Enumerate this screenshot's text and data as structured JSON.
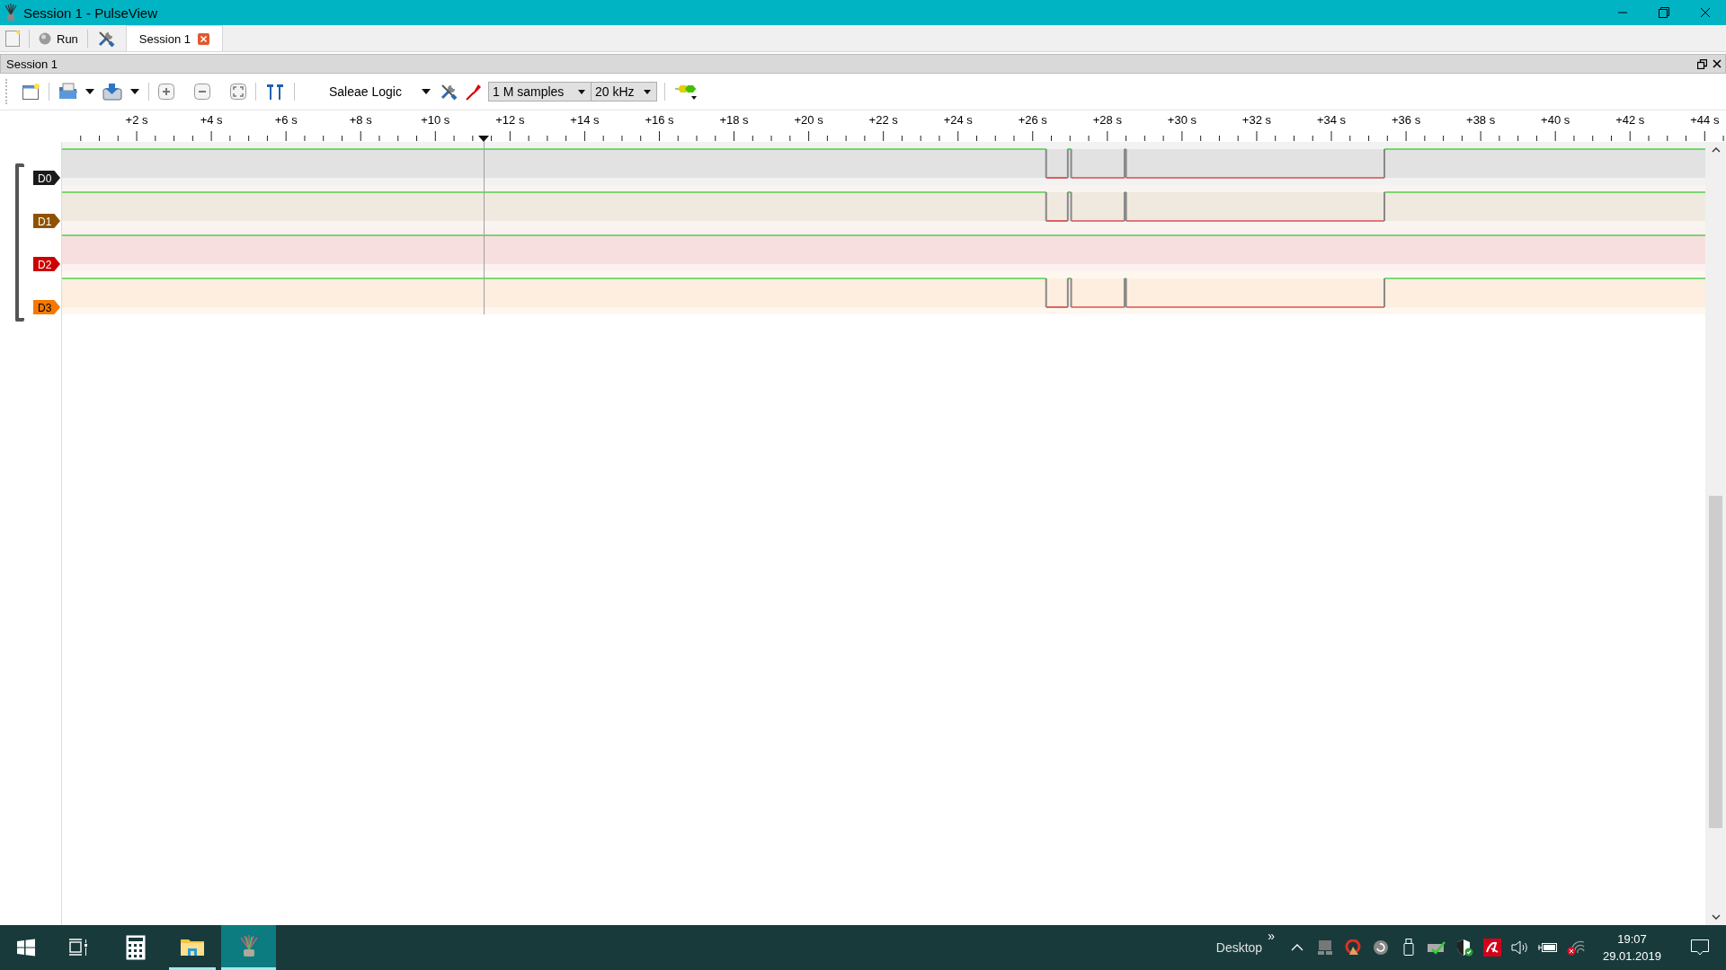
{
  "window": {
    "title": "Session 1 - PulseView"
  },
  "main_toolbar": {
    "run_button": "Run"
  },
  "tabs": [
    {
      "label": "Session 1",
      "selected": true
    }
  ],
  "session_panel": {
    "title": "Session 1"
  },
  "toolbar": {
    "device": "Saleae Logic",
    "samples": "1 M samples",
    "rate": "20 kHz"
  },
  "ruler": {
    "ticks": [
      "+2 s",
      "+4 s",
      "+6 s",
      "+8 s",
      "+10 s",
      "+12 s",
      "+14 s",
      "+16 s",
      "+18 s",
      "+20 s",
      "+22 s",
      "+24 s",
      "+26 s",
      "+28 s",
      "+30 s",
      "+32 s",
      "+34 s",
      "+36 s",
      "+38 s",
      "+40 s",
      "+42 s",
      "+44 s"
    ]
  },
  "channels": [
    {
      "name": "D0",
      "color": "#1a1a1a",
      "kind": "pulsed"
    },
    {
      "name": "D1",
      "color": "#8f5200",
      "kind": "pulsed"
    },
    {
      "name": "D2",
      "color": "#cc0000",
      "kind": "steady"
    },
    {
      "name": "D3",
      "color": "#f57900",
      "kind": "pulsed"
    }
  ],
  "taskbar": {
    "desktop": "Desktop",
    "more": "»",
    "time": "19:07",
    "date": "29.01.2019"
  }
}
